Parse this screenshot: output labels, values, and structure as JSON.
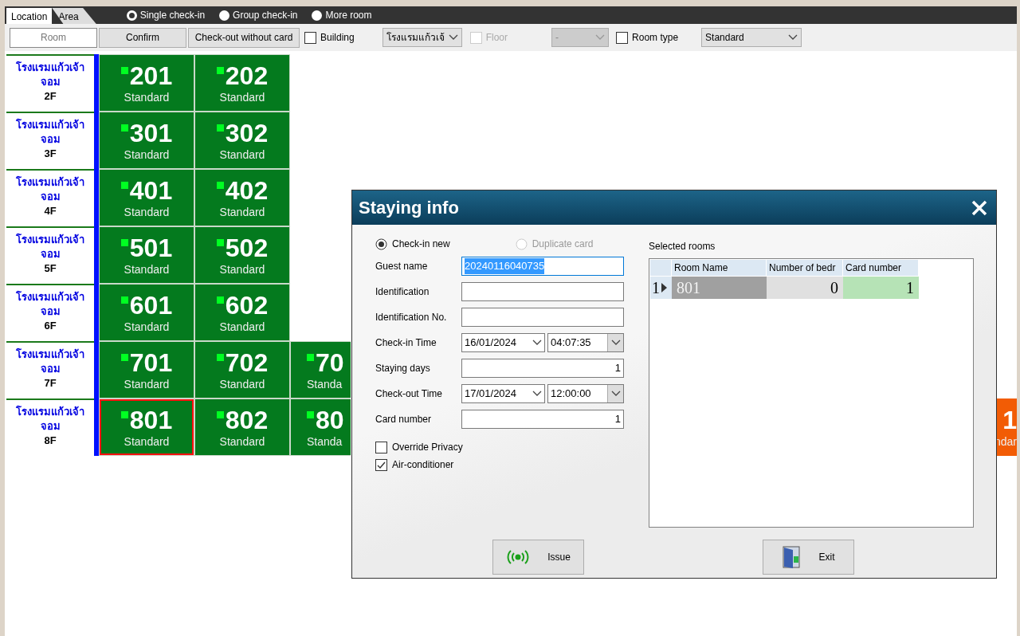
{
  "tabs": [
    {
      "label": "Location",
      "selected": true
    },
    {
      "label": "Area",
      "selected": false
    }
  ],
  "check_in_modes": [
    {
      "label": "Single check-in",
      "selected": true
    },
    {
      "label": "Group check-in",
      "selected": false
    },
    {
      "label": "More room",
      "selected": false
    }
  ],
  "toolbar": {
    "buttons": [
      {
        "label": "Room",
        "selected": true
      },
      {
        "label": "Confirm",
        "selected": false
      },
      {
        "label": "Check-out without card",
        "selected": false
      }
    ],
    "filters": [
      {
        "label": "Building",
        "checked": false,
        "disabled": false,
        "value": "โรงแรมแก้วเจ้"
      },
      {
        "label": "Floor",
        "checked": false,
        "disabled": true,
        "value": "-"
      },
      {
        "label": "Room type",
        "checked": false,
        "disabled": false,
        "value": "Standard"
      }
    ]
  },
  "floors": [
    {
      "hotel": "โรงแรมแก้วเจ้าจอม",
      "floor": "2F",
      "rooms": [
        {
          "number": "201",
          "type": "Standard",
          "selected": false,
          "color": "#047a1e",
          "dot": true
        },
        {
          "number": "202",
          "type": "Standard",
          "selected": false,
          "color": "#047a1e",
          "dot": true
        }
      ]
    },
    {
      "hotel": "โรงแรมแก้วเจ้าจอม",
      "floor": "3F",
      "rooms": [
        {
          "number": "301",
          "type": "Standard",
          "selected": false,
          "color": "#047a1e",
          "dot": true
        },
        {
          "number": "302",
          "type": "Standard",
          "selected": false,
          "color": "#047a1e",
          "dot": true
        }
      ]
    },
    {
      "hotel": "โรงแรมแก้วเจ้าจอม",
      "floor": "4F",
      "rooms": [
        {
          "number": "401",
          "type": "Standard",
          "selected": false,
          "color": "#047a1e",
          "dot": true
        },
        {
          "number": "402",
          "type": "Standard",
          "selected": false,
          "color": "#047a1e",
          "dot": true
        }
      ]
    },
    {
      "hotel": "โรงแรมแก้วเจ้าจอม",
      "floor": "5F",
      "rooms": [
        {
          "number": "501",
          "type": "Standard",
          "selected": false,
          "color": "#047a1e",
          "dot": true
        },
        {
          "number": "502",
          "type": "Standard",
          "selected": false,
          "color": "#047a1e",
          "dot": true
        }
      ]
    },
    {
      "hotel": "โรงแรมแก้วเจ้าจอม",
      "floor": "6F",
      "rooms": [
        {
          "number": "601",
          "type": "Standard",
          "selected": false,
          "color": "#047a1e",
          "dot": true
        },
        {
          "number": "602",
          "type": "Standard",
          "selected": false,
          "color": "#047a1e",
          "dot": true
        }
      ]
    },
    {
      "hotel": "โรงแรมแก้วเจ้าจอม",
      "floor": "7F",
      "rooms": [
        {
          "number": "701",
          "type": "Standard",
          "selected": false,
          "color": "#047a1e",
          "dot": true
        },
        {
          "number": "702",
          "type": "Standard",
          "selected": false,
          "color": "#047a1e",
          "dot": true
        },
        {
          "number": "70",
          "type": "Standa",
          "selected": false,
          "color": "#047a1e",
          "dot": true,
          "cut_right": true
        }
      ]
    },
    {
      "hotel": "โรงแรมแก้วเจ้าจอม",
      "floor": "8F",
      "rooms": [
        {
          "number": "801",
          "type": "Standard",
          "selected": true,
          "color": "#047a1e",
          "dot": true
        },
        {
          "number": "802",
          "type": "Standard",
          "selected": false,
          "color": "#047a1e",
          "dot": true
        },
        {
          "number": "80",
          "type": "Standa",
          "selected": false,
          "color": "#047a1e",
          "dot": true,
          "cut_right": true
        },
        {
          "number": "1",
          "type": "ndar",
          "selected": false,
          "color": "#f25c05",
          "dot": false,
          "cut_left": true
        }
      ]
    }
  ],
  "dialog": {
    "title": "Staying info",
    "modes": [
      {
        "label": "Check-in new",
        "selected": true,
        "disabled": false
      },
      {
        "label": "Duplicate card",
        "selected": false,
        "disabled": true
      }
    ],
    "fields": [
      {
        "kind": "text",
        "label": "Guest name",
        "value": "20240116040735",
        "highlighted": true
      },
      {
        "kind": "text",
        "label": "Identification"
      },
      {
        "kind": "text",
        "label": "Identification No."
      },
      {
        "kind": "datetime",
        "label": "Check-in Time",
        "date": "16/01/2024",
        "time": "04:07:35"
      },
      {
        "kind": "number",
        "label": "Staying days",
        "value": "1"
      },
      {
        "kind": "datetime",
        "label": "Check-out Time",
        "date": "17/01/2024",
        "time": "12:00:00"
      },
      {
        "kind": "number",
        "label": "Card number",
        "value": "1"
      }
    ],
    "options": [
      {
        "label": "Override Privacy",
        "checked": false
      },
      {
        "label": "Air-conditioner",
        "checked": true
      }
    ],
    "selected_rooms": {
      "label": "Selected rooms",
      "columns": [
        "Room Name",
        "Number of bedr",
        "Card number"
      ],
      "rows": [
        {
          "index": "1",
          "current": true,
          "cells": [
            "801",
            "0",
            "1"
          ]
        }
      ]
    },
    "buttons": [
      {
        "kind": "issue",
        "label": "Issue"
      },
      {
        "kind": "exit",
        "label": "Exit"
      }
    ]
  }
}
